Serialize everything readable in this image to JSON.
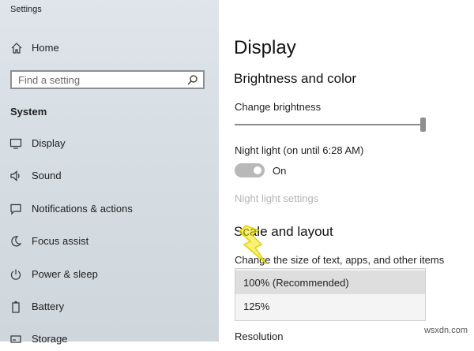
{
  "window": {
    "title": "Settings"
  },
  "sidebar": {
    "home_label": "Home",
    "search_placeholder": "Find a setting",
    "section_label": "System",
    "items": [
      {
        "label": "Display",
        "icon": "monitor-icon"
      },
      {
        "label": "Sound",
        "icon": "speaker-icon"
      },
      {
        "label": "Notifications & actions",
        "icon": "notification-icon"
      },
      {
        "label": "Focus assist",
        "icon": "moon-icon"
      },
      {
        "label": "Power & sleep",
        "icon": "power-icon"
      },
      {
        "label": "Battery",
        "icon": "battery-icon"
      },
      {
        "label": "Storage",
        "icon": "storage-icon"
      }
    ]
  },
  "main": {
    "title": "Display",
    "brightness": {
      "heading": "Brightness and color",
      "change_label": "Change brightness",
      "level": 1.0
    },
    "night_light": {
      "label": "Night light (on until 6:28 AM)",
      "state_text": "On",
      "settings_link": "Night light settings"
    },
    "scale": {
      "heading": "Scale and layout",
      "size_label": "Change the size of text, apps, and other items",
      "options": [
        "100% (Recommended)",
        "125%"
      ],
      "selected": "100% (Recommended)"
    },
    "resolution_label": "Resolution"
  },
  "watermark": "wsxdn.com",
  "colors": {
    "sidebar_bg": "#d8dfe5",
    "toggle_bg": "#b8b8b8",
    "disabled_text": "#b5b5b5",
    "highlight_bolt": "#f2e600"
  }
}
